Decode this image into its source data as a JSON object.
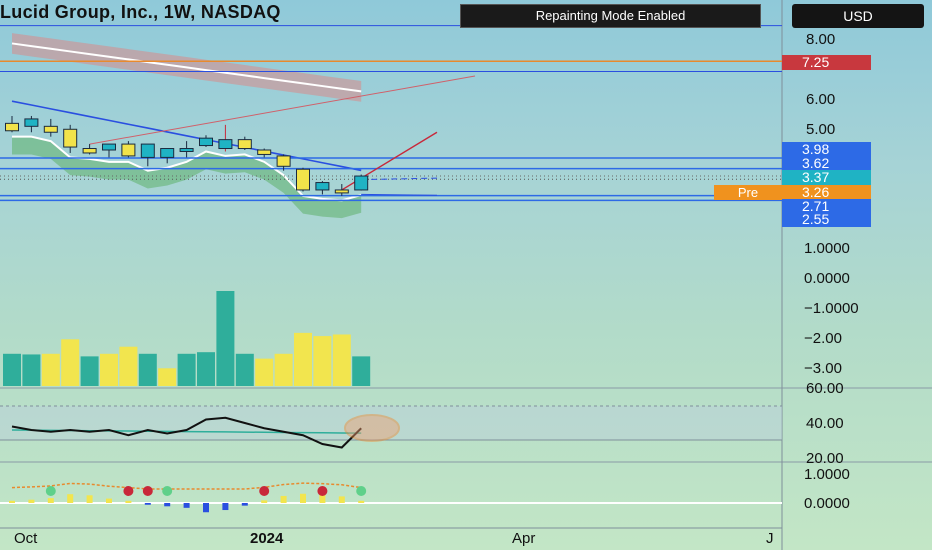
{
  "header": {
    "title": "Lucid Group, Inc., 1W, NASDAQ",
    "repaint_badge": "Repainting Mode Enabled",
    "currency_button": "USD"
  },
  "price_axis": {
    "ticks": [
      "8.00",
      "7.00",
      "6.00",
      "5.00"
    ],
    "tags": [
      {
        "label": "7.25",
        "value": 7.25,
        "color": "#c8383e"
      },
      {
        "label": "3.98",
        "value": 3.98,
        "color": "#2d6ae6"
      },
      {
        "label": "3.62",
        "value": 3.62,
        "color": "#2d6ae6"
      },
      {
        "label": "3.37",
        "value": 3.37,
        "color": "#1fb3c4"
      },
      {
        "label": "3.26",
        "value": 3.26,
        "color": "#f0921e"
      },
      {
        "label": "2.71",
        "value": 2.71,
        "color": "#2d6ae6"
      },
      {
        "label": "2.55",
        "value": 2.55,
        "color": "#2d6ae6"
      }
    ],
    "pre_label": "Pre"
  },
  "volume_axis": {
    "ticks": [
      "1.0000",
      "0.0000",
      "−1.0000",
      "−2.00",
      "−3.00"
    ]
  },
  "rsi_axis": {
    "ticks": [
      "60.00",
      "40.00",
      "20.00"
    ]
  },
  "osc_axis": {
    "ticks": [
      "1.0000",
      "0.0000"
    ]
  },
  "time_axis": {
    "ticks": [
      "Oct",
      "2024",
      "Apr",
      "J"
    ]
  },
  "chart_data": [
    {
      "type": "candlestick",
      "name": "price",
      "categories": [
        "W1",
        "W2",
        "W3",
        "W4",
        "W5",
        "W6",
        "W7",
        "W8",
        "W9",
        "W10",
        "W11",
        "W12",
        "W13",
        "W14",
        "W15",
        "W16",
        "W17",
        "W18",
        "W19"
      ],
      "open": [
        5.15,
        5.05,
        5.05,
        4.95,
        4.3,
        4.25,
        4.45,
        4.0,
        4.0,
        4.2,
        4.4,
        4.3,
        4.6,
        4.25,
        4.05,
        3.6,
        2.9,
        2.9,
        2.9
      ],
      "high": [
        5.4,
        5.4,
        5.3,
        5.1,
        4.45,
        4.45,
        4.55,
        4.4,
        4.25,
        4.55,
        4.75,
        5.1,
        4.7,
        4.3,
        4.1,
        3.65,
        3.2,
        3.1,
        3.42
      ],
      "low": [
        4.85,
        4.85,
        4.7,
        4.15,
        4.1,
        4.0,
        4.0,
        3.7,
        3.8,
        4.0,
        4.35,
        4.2,
        4.25,
        4.0,
        3.55,
        2.85,
        2.75,
        2.7,
        2.88
      ],
      "close": [
        4.9,
        5.3,
        4.85,
        4.35,
        4.15,
        4.45,
        4.05,
        4.45,
        4.3,
        4.3,
        4.65,
        4.6,
        4.3,
        4.1,
        3.7,
        2.9,
        3.15,
        2.8,
        3.37
      ],
      "ylim": [
        2.45,
        8.3
      ],
      "levels": [
        7.25,
        3.98,
        3.62,
        3.37,
        3.26,
        2.71,
        2.55
      ]
    },
    {
      "type": "bar",
      "name": "volume",
      "values": [
        1.0,
        0.98,
        1.0,
        1.45,
        0.92,
        1.0,
        1.22,
        1.0,
        0.55,
        1.0,
        1.05,
        2.95,
        1.0,
        0.85,
        1.0,
        1.65,
        1.55,
        1.6,
        0.92
      ],
      "colors": [
        "teal",
        "teal",
        "yellow",
        "yellow",
        "teal",
        "yellow",
        "yellow",
        "teal",
        "yellow",
        "teal",
        "teal",
        "teal",
        "teal",
        "yellow",
        "yellow",
        "yellow",
        "yellow",
        "yellow",
        "teal"
      ],
      "ylim": [
        0,
        3.2
      ]
    },
    {
      "type": "line",
      "name": "rsi",
      "values": [
        38,
        36,
        35,
        36,
        35,
        36,
        33,
        36,
        34,
        36,
        42,
        43,
        40,
        37,
        35,
        33,
        28,
        26,
        37
      ],
      "ylim": [
        20,
        60
      ]
    },
    {
      "type": "bar",
      "name": "oscillator",
      "values": [
        0.1,
        0.15,
        0.22,
        0.4,
        0.35,
        0.2,
        0.1,
        -0.08,
        -0.15,
        -0.22,
        -0.42,
        -0.32,
        -0.12,
        0.12,
        0.32,
        0.42,
        0.38,
        0.3,
        0.1
      ],
      "ylim": [
        -0.5,
        1.2
      ]
    }
  ]
}
